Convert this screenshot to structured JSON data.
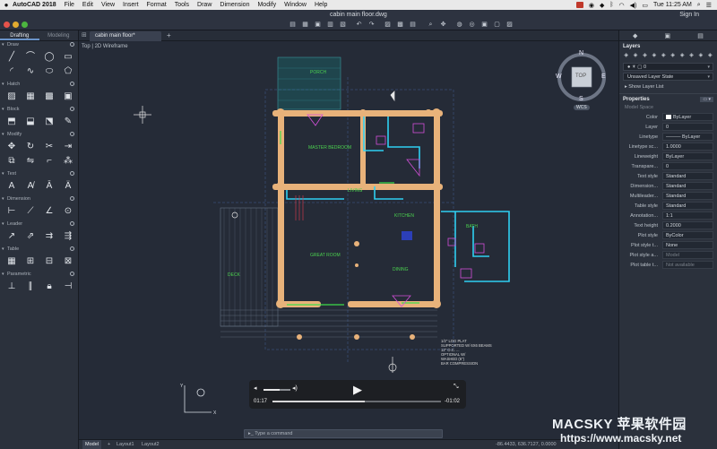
{
  "menubar": {
    "app_name": "AutoCAD 2018",
    "items": [
      "File",
      "Edit",
      "View",
      "Insert",
      "Format",
      "Tools",
      "Draw",
      "Dimension",
      "Modify",
      "Window",
      "Help"
    ],
    "clock": "Tue 11:25 AM"
  },
  "titlebar": {
    "title": "cabin main floor.dwg",
    "signin": "Sign In"
  },
  "toolbox": {
    "tabs": [
      "Drafting",
      "Modeling"
    ],
    "sections": [
      {
        "label": "Draw"
      },
      {
        "label": "Hatch"
      },
      {
        "label": "Block"
      },
      {
        "label": "Modify"
      },
      {
        "label": "Text"
      },
      {
        "label": "Dimension"
      },
      {
        "label": "Leader"
      },
      {
        "label": "Table"
      },
      {
        "label": "Parametric"
      }
    ]
  },
  "doctab": {
    "label": "cabin main floor*"
  },
  "viewport": {
    "label": "Top | 2D Wireframe",
    "viewcube": {
      "face": "TOP",
      "n": "N",
      "s": "S",
      "e": "E",
      "w": "W",
      "wcs": "WCS"
    },
    "note_lines": [
      "1/2\" LOG PLAT",
      "SUPPORTED W/ 6X6 BEAMS",
      "12\" O.C. ...",
      "OPTIONAL W/",
      "WASHED (6\")",
      "BAR COMPRESSION"
    ],
    "room_labels": [
      "MASTER BEDROOM",
      "KITCHEN",
      "BATH",
      "PORCH",
      "GREAT ROOM",
      "DINING",
      "LIVING",
      "DECK"
    ]
  },
  "palette": {
    "layers_title": "Layers",
    "layer_value": "0",
    "layer_state": "Unsaved Layer State",
    "show_layer_list": "Show Layer List",
    "properties_title": "Properties",
    "space": "Model Space",
    "props": [
      {
        "label": "Color",
        "value": "ByLayer",
        "swatch": true
      },
      {
        "label": "Layer",
        "value": "0"
      },
      {
        "label": "Linetype",
        "value": "——— ByLayer"
      },
      {
        "label": "Linetype sc...",
        "value": "1.0000"
      },
      {
        "label": "Lineweight",
        "value": "ByLayer"
      },
      {
        "label": "Transpare...",
        "value": "0"
      },
      {
        "label": "Text style",
        "value": "Standard"
      },
      {
        "label": "Dimension...",
        "value": "Standard"
      },
      {
        "label": "Multileader...",
        "value": "Standard"
      },
      {
        "label": "Table style",
        "value": "Standard"
      },
      {
        "label": "Annotation...",
        "value": "1:1"
      },
      {
        "label": "Text height",
        "value": "0.2000"
      },
      {
        "label": "Plot style",
        "value": "ByColor"
      },
      {
        "label": "Plot style t...",
        "value": "None"
      },
      {
        "label": "Plot style a...",
        "value": "Model",
        "dim": true
      },
      {
        "label": "Plot table t...",
        "value": "Not available",
        "dim": true
      }
    ]
  },
  "statusbar": {
    "tabs": [
      "Model",
      "Layout1",
      "Layout2"
    ],
    "coords": "-86.4433, 636.7127, 0.0000"
  },
  "cmdline": {
    "placeholder": "Type a command"
  },
  "player": {
    "elapsed": "01:17",
    "remaining": "-01:02",
    "progress": 0.55
  },
  "watermark": {
    "line1": "MACSKY 苹果软件园",
    "line2": "https://www.macsky.net"
  }
}
